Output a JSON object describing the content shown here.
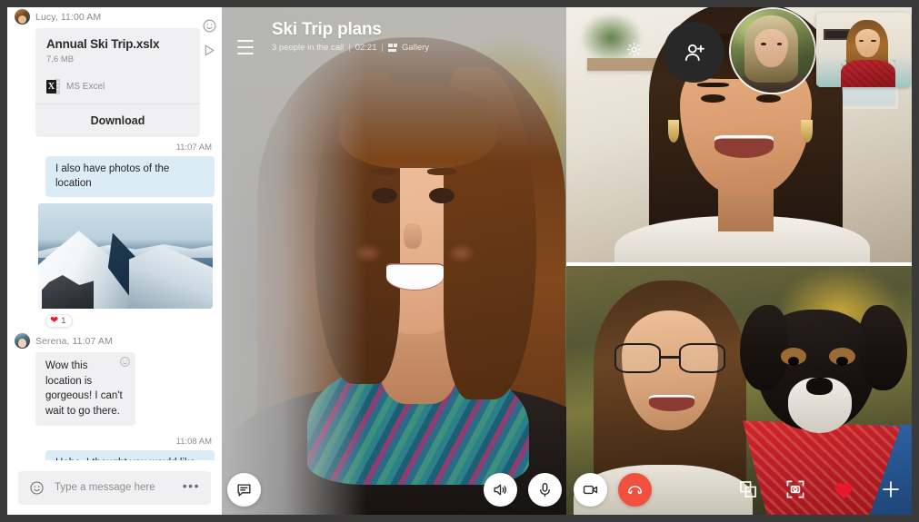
{
  "window": {
    "frame_color": "#3a3a3a"
  },
  "chat": {
    "file_message": {
      "sender_line": "Lucy, 11:00 AM",
      "file_name": "Annual Ski Trip.xslx",
      "file_size": "7,6 MB",
      "file_type": "MS Excel",
      "file_type_badge": "X",
      "download_label": "Download",
      "hover_tools": [
        "emoji-reaction-icon",
        "forward-icon"
      ]
    },
    "messages": [
      {
        "id": "m1",
        "direction": "out",
        "timestamp": "11:07 AM",
        "text": "I also have photos of the location"
      },
      {
        "id": "m2",
        "direction": "out",
        "type": "image",
        "alt": "snowy-mountain-ridge-photo",
        "reaction": {
          "icon": "heart-icon",
          "count": "1",
          "color": "#e8192c"
        }
      },
      {
        "id": "m3",
        "direction": "in",
        "sender_line": "Serena, 11:07 AM",
        "text": "Wow this location is gorgeous! I can't wait to go there."
      },
      {
        "id": "m4",
        "direction": "out",
        "timestamp": "11:08 AM",
        "text": "Hehe, I thought you would like it.",
        "read_receipts": [
          "avatar-lucy",
          "avatar-serena"
        ]
      }
    ],
    "composer": {
      "placeholder": "Type a message here",
      "value": "",
      "emoji_icon": "smiley-icon",
      "more_icon": "more-options-icon",
      "more_label": "•••"
    },
    "bubble_out_color": "#dcecf7",
    "bubble_in_color": "#f0f0f2"
  },
  "call": {
    "title": "Ski Trip plans",
    "participants_text": "3 people in the call",
    "separator": "|",
    "duration": "02:21",
    "layout_label": "Gallery",
    "menu_icon": "hamburger-menu-icon",
    "settings_icon": "gear-icon",
    "add_people_icon": "add-person-icon",
    "controls": [
      {
        "name": "chat-toggle",
        "icon": "chat-bubble-icon",
        "style": "white"
      },
      {
        "name": "speaker",
        "icon": "speaker-icon",
        "style": "white"
      },
      {
        "name": "microphone",
        "icon": "microphone-icon",
        "style": "white"
      },
      {
        "name": "camera",
        "icon": "video-camera-icon",
        "style": "white"
      },
      {
        "name": "end-call",
        "icon": "hang-up-icon",
        "style": "red",
        "color": "#f0503c"
      }
    ],
    "side_actions": [
      {
        "name": "share-screen",
        "icon": "screen-share-icon"
      },
      {
        "name": "take-snapshot",
        "icon": "snapshot-icon"
      },
      {
        "name": "send-reaction",
        "icon": "heart-icon",
        "color": "#e8192c"
      },
      {
        "name": "more-actions",
        "icon": "plus-icon"
      }
    ],
    "tiles": [
      {
        "id": "main",
        "alt": "woman-smiling-outdoors-main-speaker"
      },
      {
        "id": "gallery-top",
        "alt": "woman-laughing-indoors"
      },
      {
        "id": "gallery-bottom",
        "alt": "woman-with-glasses-holding-dog"
      },
      {
        "id": "avatar-circle",
        "alt": "participant-avatar-outdoors"
      },
      {
        "id": "self-view",
        "alt": "self-view-woman-in-red"
      }
    ]
  }
}
